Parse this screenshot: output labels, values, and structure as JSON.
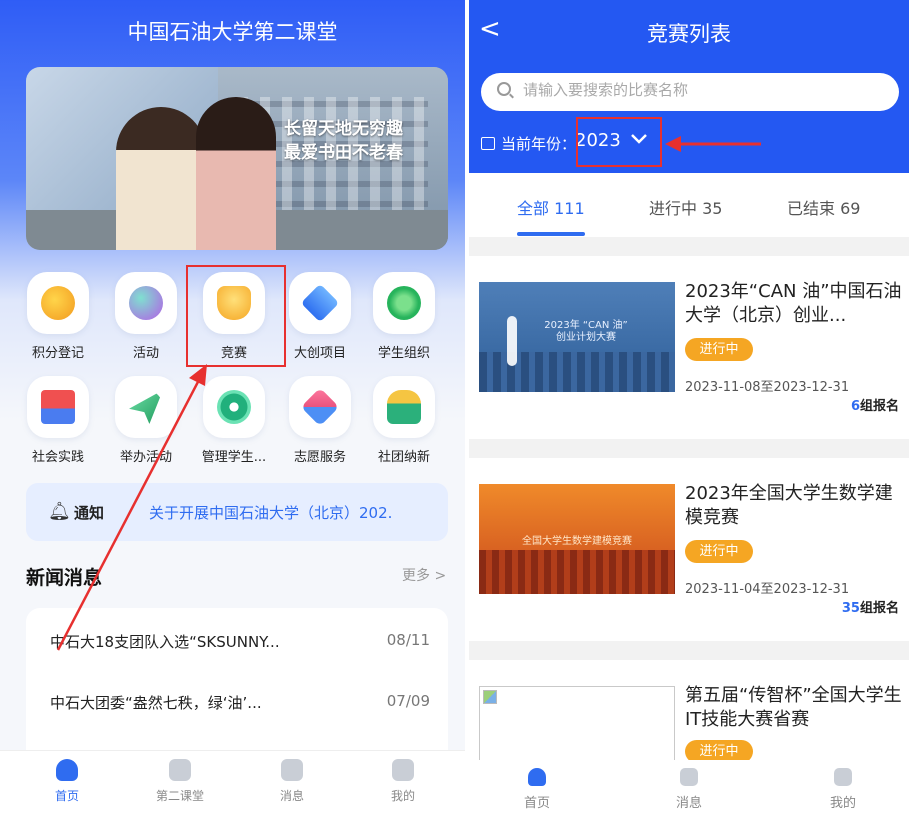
{
  "left": {
    "title": "中国石油大学第二课堂",
    "banner": {
      "line1": "长留天地无穷趣",
      "line2": "最爱书田不老春"
    },
    "grid": [
      {
        "label": "积分登记",
        "icon": "points-register-icon",
        "color": "#f5b42a"
      },
      {
        "label": "活动",
        "icon": "balloon-icon",
        "color": "#c06ae8"
      },
      {
        "label": "竞赛",
        "icon": "trophy-icon",
        "color": "#f5a623"
      },
      {
        "label": "大创项目",
        "icon": "layers-icon",
        "color": "#2e7df0"
      },
      {
        "label": "学生组织",
        "icon": "network-icon",
        "color": "#27b45c"
      },
      {
        "label": "社会实践",
        "icon": "flag-icon",
        "color": "#e64a4a"
      },
      {
        "label": "举办活动",
        "icon": "paper-plane-icon",
        "color": "#27a86a"
      },
      {
        "label": "管理学生...",
        "icon": "gears-icon",
        "color": "#1fae7a"
      },
      {
        "label": "志愿服务",
        "icon": "volunteer-icon",
        "color": "#e9537e"
      },
      {
        "label": "社团纳新",
        "icon": "people-icon",
        "color": "#2bb07b"
      }
    ],
    "notice": {
      "label": "通知",
      "text": "关于开展中国石油大学（北京）202."
    },
    "news": {
      "title": "新闻消息",
      "more": "更多 >",
      "items": [
        {
          "title": "中石大18支团队入选“SKSUNNY...",
          "date": "08/11"
        },
        {
          "title": "中石大团委“盎然七秩，绿‘油’...",
          "date": "07/09"
        }
      ]
    },
    "tabbar": [
      {
        "label": "首页",
        "icon": "home-icon"
      },
      {
        "label": "第二课堂",
        "icon": "book-icon"
      },
      {
        "label": "消息",
        "icon": "message-icon"
      },
      {
        "label": "我的",
        "icon": "profile-icon"
      }
    ]
  },
  "right": {
    "back": "<",
    "title": "竞赛列表",
    "search_placeholder": "请输入要搜索的比赛名称",
    "year_label": "当前年份：",
    "year_value": "2023",
    "tabs": [
      {
        "label": "全部 111"
      },
      {
        "label": "进行中 35"
      },
      {
        "label": "已结束 69"
      }
    ],
    "cards": [
      {
        "title": "2023年“CAN 油”中国石油大学（北京）创业...",
        "status": "进行中",
        "dates": "2023-11-08至2023-12-31",
        "count": "6",
        "count_suffix": "组报名",
        "img_text": "2023年 “CAN 油” 创业计划大赛"
      },
      {
        "title": "2023年全国大学生数学建模竞赛",
        "status": "进行中",
        "dates": "2023-11-04至2023-12-31",
        "count": "35",
        "count_suffix": "组报名",
        "img_text": "全国大学生数学建模竞赛"
      },
      {
        "title": "第五届“传智杯”全国大学生IT技能大赛省赛",
        "status": "进行中"
      }
    ],
    "tabbar": [
      {
        "label": "首页",
        "icon": "home-icon"
      },
      {
        "label": "消息",
        "icon": "message-icon"
      },
      {
        "label": "我的",
        "icon": "profile-icon"
      }
    ]
  },
  "colors": {
    "primary": "#2458f2",
    "accent_orange": "#f5a623",
    "highlight_red": "#e7302f"
  }
}
